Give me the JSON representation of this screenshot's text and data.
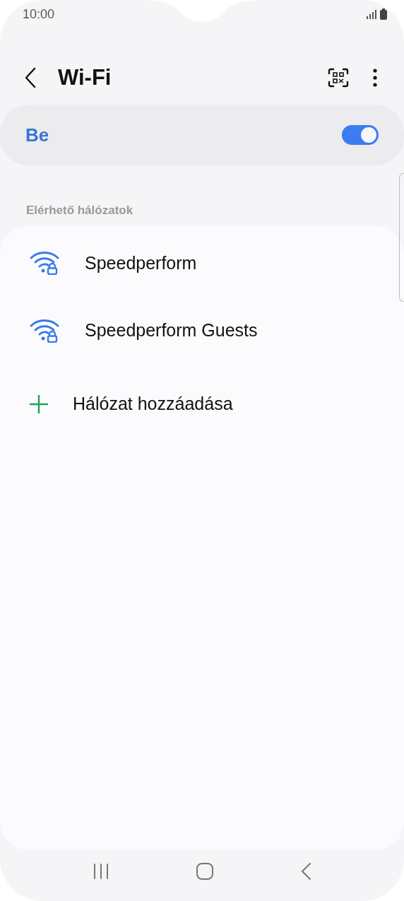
{
  "status_bar": {
    "time": "10:00"
  },
  "header": {
    "title": "Wi-Fi"
  },
  "wifi_toggle": {
    "label": "Be",
    "on": true
  },
  "section_title": "Elérhető hálózatok",
  "networks": [
    {
      "kind": "network",
      "name": "Speedperform",
      "secured": true
    },
    {
      "kind": "network",
      "name": "Speedperform Guests",
      "secured": true
    },
    {
      "kind": "add",
      "name": "Hálózat hozzáadása"
    }
  ]
}
